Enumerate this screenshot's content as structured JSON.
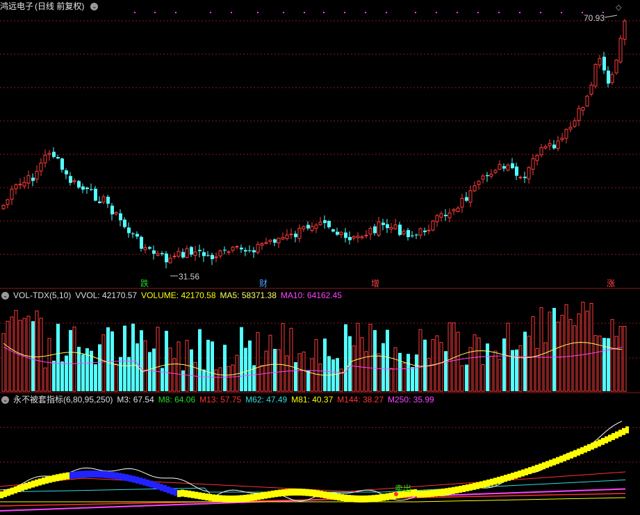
{
  "header": {
    "title": "鸿远电子",
    "subtitle": "(日线 前复权)"
  },
  "price_panel": {
    "high_label": "70.93",
    "low_label": "31.56",
    "events": [
      {
        "text": "跌",
        "color": "#22cc22"
      },
      {
        "text": "财",
        "color": "#4aa0ff"
      },
      {
        "text": "增",
        "color": "#ff4444"
      },
      {
        "text": "涨",
        "color": "#ff4444"
      }
    ]
  },
  "vol_panel": {
    "name": "VOL-TDX(5,10)",
    "items": [
      {
        "label": "VVOL: 42170.57",
        "color": "#e0e0e0"
      },
      {
        "label": "VOLUME: 42170.58",
        "color": "#ffff00"
      },
      {
        "label": "MA5: 58371.38",
        "color": "#ffff66"
      },
      {
        "label": "MA10: 64162.45",
        "color": "#ff44ff"
      }
    ]
  },
  "ind_panel": {
    "name": "永不被套指标(6,80,95,250)",
    "items": [
      {
        "label": "M3: 67.54",
        "color": "#e0e0e0"
      },
      {
        "label": "M8: 64.06",
        "color": "#22dd22"
      },
      {
        "label": "M13: 57.75",
        "color": "#ff3333"
      },
      {
        "label": "M62: 47.49",
        "color": "#33dddd"
      },
      {
        "label": "M81: 40.37",
        "color": "#ffff00"
      },
      {
        "label": "M144: 38.27",
        "color": "#ff3333"
      },
      {
        "label": "M250: 35.99",
        "color": "#ff44ff"
      }
    ],
    "signal_label": "卖出"
  },
  "colors": {
    "up": "#ff3c3c",
    "down": "#54ffff",
    "grid": "#8b1a1a",
    "ma5": "#ffff66",
    "ma10": "#ff44ff"
  },
  "chart_data": {
    "type": "candlestick",
    "price_ylim": [
      30,
      72
    ],
    "volume_ylim": [
      0,
      130000
    ],
    "indicator_ylim": [
      0,
      100
    ]
  }
}
